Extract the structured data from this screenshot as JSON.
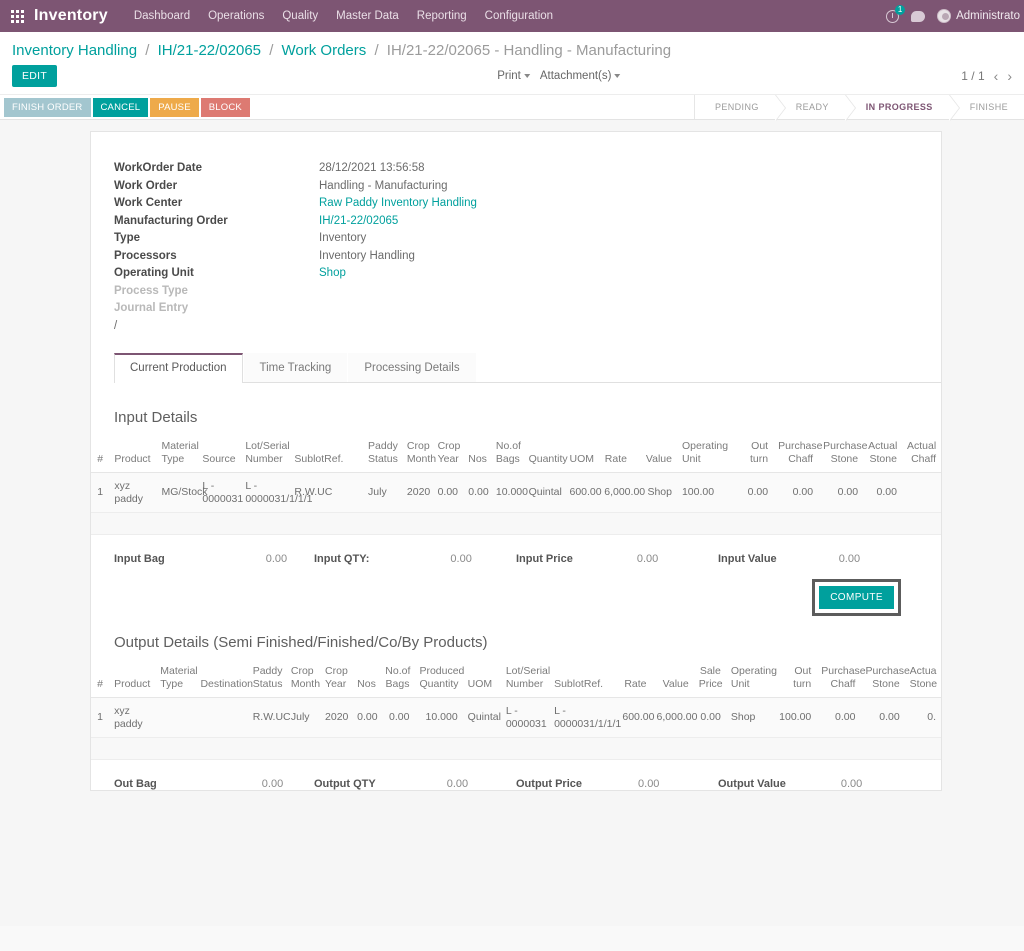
{
  "navbar": {
    "apps_icon": "apps-grid-icon",
    "brand": "Inventory",
    "menu": [
      {
        "label": "Dashboard"
      },
      {
        "label": "Operations"
      },
      {
        "label": "Quality"
      },
      {
        "label": "Master Data"
      },
      {
        "label": "Reporting"
      },
      {
        "label": "Configuration"
      }
    ],
    "activity_icon": "clock-icon",
    "activity_count": "1",
    "messages_icon": "chat-bubble-icon",
    "avatar_icon": "avatar-icon",
    "user": "Administrato"
  },
  "breadcrumb": {
    "item1": "Inventory Handling",
    "item2": "IH/21-22/02065",
    "item3": "Work Orders",
    "current": "IH/21-22/02065 - Handling - Manufacturing",
    "sep": "/"
  },
  "controls": {
    "edit_label": "EDIT",
    "print_label": "Print",
    "attachments_label": "Attachment(s)",
    "pager_text": "1 / 1",
    "prev_icon": "chevron-left-icon",
    "next_icon": "chevron-right-icon"
  },
  "actions": [
    {
      "label": "FINISH ORDER",
      "color": "#a3c6cf",
      "name": "finish-order-button"
    },
    {
      "label": "CANCEL",
      "color": "#00a09d",
      "name": "cancel-button"
    },
    {
      "label": "PAUSE",
      "color": "#eeaa4a",
      "name": "pause-button"
    },
    {
      "label": "BLOCK",
      "color": "#dd7a72",
      "name": "block-button"
    }
  ],
  "status_steps": [
    {
      "label": "PENDING",
      "active": false
    },
    {
      "label": "READY",
      "active": false
    },
    {
      "label": "IN PROGRESS",
      "active": true
    },
    {
      "label": "FINISHE",
      "active": false
    }
  ],
  "form_fields": [
    {
      "label": "WorkOrder Date",
      "value": "28/12/2021 13:56:58",
      "link": false,
      "dim": false
    },
    {
      "label": "Work Order",
      "value": "Handling - Manufacturing",
      "link": false,
      "dim": false
    },
    {
      "label": "Work Center",
      "value": "Raw Paddy Inventory Handling",
      "link": true,
      "dim": false
    },
    {
      "label": "Manufacturing Order",
      "value": "IH/21-22/02065",
      "link": true,
      "dim": false
    },
    {
      "label": "Type",
      "value": "Inventory",
      "link": false,
      "dim": false
    },
    {
      "label": "Processors",
      "value": "Inventory Handling",
      "link": false,
      "dim": false
    },
    {
      "label": "Operating Unit",
      "value": "Shop",
      "link": true,
      "dim": false
    },
    {
      "label": "Process Type",
      "value": "",
      "link": false,
      "dim": true
    },
    {
      "label": "Journal Entry",
      "value": "",
      "link": false,
      "dim": true
    }
  ],
  "journal_slash": "/",
  "tabs": [
    {
      "label": "Current Production",
      "active": true
    },
    {
      "label": "Time Tracking",
      "active": false
    },
    {
      "label": "Processing Details",
      "active": false
    }
  ],
  "input_section": {
    "title": "Input Details",
    "headers": [
      "#",
      "Product",
      "Material Type",
      "Source",
      "Lot/Serial Number",
      "SublotRef.",
      "Paddy Status",
      "Crop Month",
      "Crop Year",
      "Nos",
      "No.of Bags",
      "Quantity",
      "UOM",
      "Rate",
      "Value",
      "Operating Unit",
      "Out turn",
      "Purchase Chaff",
      "Purchase Stone",
      "Actual Stone",
      "Actual Chaff"
    ],
    "rows": [
      [
        "1",
        "xyz paddy",
        "MG/Stock",
        "L - 0000031",
        "L - 0000031/1/1/1",
        "R.W.UC",
        "July",
        "2020",
        "0.00",
        "0.00",
        "10.000",
        "Quintal",
        "600.00",
        "6,000.00",
        "Shop",
        "100.00",
        "0.00",
        "0.00",
        "0.00",
        "0.00"
      ]
    ],
    "totals": [
      {
        "label": "Input Bag",
        "value": "0.00"
      },
      {
        "label": "Input QTY:",
        "value": "0.00"
      },
      {
        "label": "Input Price",
        "value": "0.00"
      },
      {
        "label": "Input Value",
        "value": "0.00"
      }
    ]
  },
  "compute": {
    "label": "COMPUTE"
  },
  "output_section": {
    "title": "Output Details (Semi Finished/Finished/Co/By Products)",
    "headers": [
      "#",
      "Product",
      "Material Type",
      "Destination",
      "Paddy Status",
      "Crop Month",
      "Crop Year",
      "Nos",
      "No.of Bags",
      "Produced Quantity",
      "UOM",
      "Lot/Serial Number",
      "SublotRef.",
      "Rate",
      "Value",
      "Sale Price",
      "Operating Unit",
      "Out turn",
      "Purchase Chaff",
      "Purchase Stone",
      "Actua Stone"
    ],
    "rows": [
      [
        "1",
        "xyz paddy",
        "",
        "",
        "R.W.UC",
        "July",
        "2020",
        "0.00",
        "0.00",
        "10.000",
        "Quintal",
        "L - 0000031",
        "L - 0000031/1/1/1",
        "600.00",
        "6,000.00",
        "0.00",
        "Shop",
        "100.00",
        "0.00",
        "0.00",
        "0."
      ]
    ],
    "totals": [
      {
        "label": "Out Bag",
        "value": "0.00"
      },
      {
        "label": "Output QTY",
        "value": "0.00"
      },
      {
        "label": "Output Price",
        "value": "0.00"
      },
      {
        "label": "Output Value",
        "value": "0.00"
      }
    ]
  }
}
